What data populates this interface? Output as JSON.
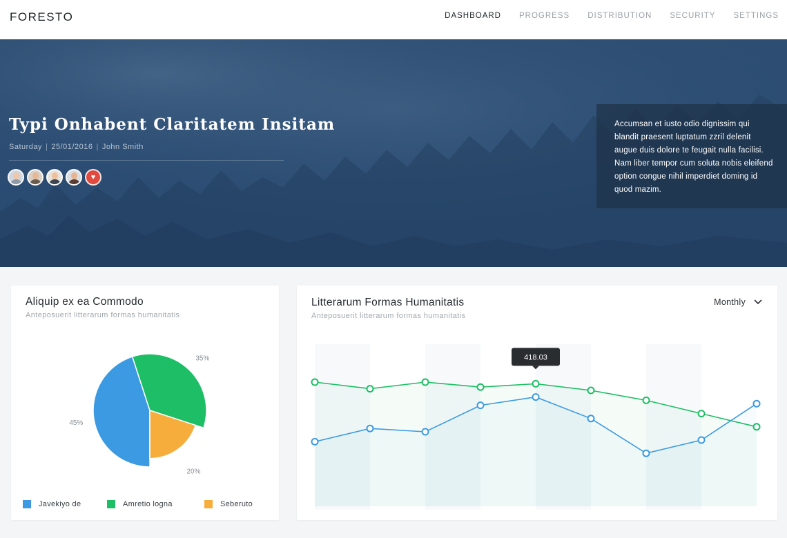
{
  "brand": "FORESTO",
  "nav": [
    {
      "label": "DASHBOARD",
      "active": true
    },
    {
      "label": "PROGRESS",
      "active": false
    },
    {
      "label": "DISTRIBUTION",
      "active": false
    },
    {
      "label": "SECURITY",
      "active": false
    },
    {
      "label": "SETTINGS",
      "active": false
    }
  ],
  "hero": {
    "title": "Typi Onhabent Claritatem Insitam",
    "day": "Saturday",
    "date": "25/01/2016",
    "author": "John Smith",
    "quote": "Accumsan et iusto odio dignissim qui blandit praesent luptatum zzril delenit augue duis dolore te feugait nulla facilisi. Nam liber tempor cum soluta nobis eleifend option congue nihil imperdiet doming id quod mazim.",
    "avatar_count": 4
  },
  "pie_card": {
    "title": "Aliquip ex ea Commodo",
    "subtitle": "Anteposuerit litterarum formas humanitatis"
  },
  "line_card": {
    "title": "Litterarum Formas Humanitatis",
    "subtitle": "Anteposuerit litterarum formas humanitatis",
    "dropdown": "Monthly",
    "tooltip": "418.03"
  },
  "colors": {
    "blue": "#3b9ae1",
    "green": "#1dbe65",
    "orange": "#f7ad3c"
  },
  "chart_data": [
    {
      "type": "pie",
      "labels": [
        "Javekiyo de",
        "Amretio logna",
        "Seberuto"
      ],
      "values": [
        45,
        35,
        20
      ],
      "value_labels": [
        "45%",
        "35%",
        "20%"
      ]
    },
    {
      "type": "line",
      "x": [
        1,
        2,
        3,
        4,
        5,
        6,
        7,
        8,
        9
      ],
      "ylim": [
        0,
        100
      ],
      "grid": false,
      "series": [
        {
          "color": "#1dbe65",
          "values": [
            75,
            71,
            75,
            72,
            74,
            70,
            64,
            56,
            48
          ]
        },
        {
          "color": "#3b9ae1",
          "values": [
            39,
            47,
            45,
            61,
            66,
            53,
            32,
            40,
            62
          ]
        }
      ],
      "tooltip_point": 4
    }
  ]
}
